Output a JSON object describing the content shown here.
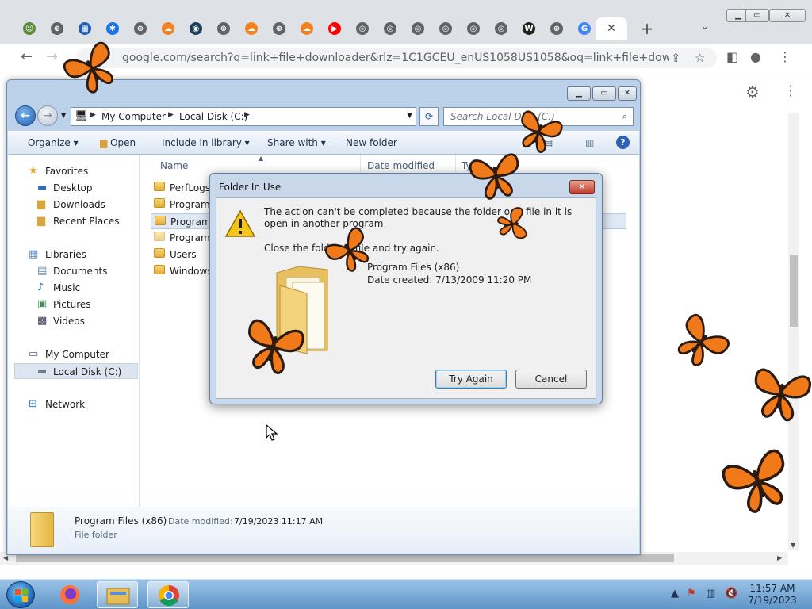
{
  "browser": {
    "url": "google.com/search?q=link+file+downloader&rlz=1C1GCEU_enUS1058US1058&oq=link+file+downloader&...",
    "tabs": [
      {
        "icon": "extension-icon",
        "color": "#5a8a3a",
        "glyph": "☺"
      },
      {
        "icon": "globe-icon",
        "color": "#5f6368",
        "glyph": "⊕"
      },
      {
        "icon": "app-icon",
        "color": "#1a5fb4",
        "glyph": "▦"
      },
      {
        "icon": "gear-icon",
        "color": "#1a73e8",
        "glyph": "✱"
      },
      {
        "icon": "globe-icon",
        "color": "#5f6368",
        "glyph": "⊕"
      },
      {
        "icon": "cloudflare-icon",
        "color": "#f48120",
        "glyph": "☁"
      },
      {
        "icon": "camera-icon",
        "color": "#1c3f5e",
        "glyph": "◉"
      },
      {
        "icon": "globe-icon",
        "color": "#5f6368",
        "glyph": "⊕"
      },
      {
        "icon": "cloudflare-icon",
        "color": "#f48120",
        "glyph": "☁"
      },
      {
        "icon": "globe-icon",
        "color": "#5f6368",
        "glyph": "⊕"
      },
      {
        "icon": "cloudflare-icon",
        "color": "#f48120",
        "glyph": "☁"
      },
      {
        "icon": "youtube-icon",
        "color": "#ff0000",
        "glyph": "▶"
      },
      {
        "icon": "chromium-icon",
        "color": "#5f6368",
        "glyph": "◎"
      },
      {
        "icon": "chromium-icon",
        "color": "#5f6368",
        "glyph": "◎"
      },
      {
        "icon": "chromium-icon",
        "color": "#5f6368",
        "glyph": "◎"
      },
      {
        "icon": "chromium-icon",
        "color": "#5f6368",
        "glyph": "◎"
      },
      {
        "icon": "chromium-icon",
        "color": "#5f6368",
        "glyph": "◎"
      },
      {
        "icon": "chromium-icon",
        "color": "#5f6368",
        "glyph": "◎"
      },
      {
        "icon": "wikipedia-icon",
        "color": "#222222",
        "glyph": "W"
      },
      {
        "icon": "globe-icon",
        "color": "#5f6368",
        "glyph": "⊕"
      },
      {
        "icon": "google-icon",
        "color": "#4285f4",
        "glyph": "G"
      }
    ]
  },
  "explorer": {
    "breadcrumb": [
      "My Computer",
      "Local Disk (C:)"
    ],
    "search_placeholder": "Search Local Disk (C:)",
    "commands": [
      "Organize",
      "Open",
      "Include in library",
      "Share with",
      "New folder"
    ],
    "nav": {
      "favorites": "Favorites",
      "desktop": "Desktop",
      "downloads": "Downloads",
      "recent": "Recent Places",
      "libraries": "Libraries",
      "documents": "Documents",
      "music": "Music",
      "pictures": "Pictures",
      "videos": "Videos",
      "computer": "My Computer",
      "localdisk": "Local Disk (C:)",
      "network": "Network"
    },
    "columns": {
      "name": "Name",
      "date": "Date modified",
      "type": "Type"
    },
    "files": [
      "PerfLogs",
      "Program",
      "Program",
      "ProgramD",
      "Users",
      "Windows"
    ],
    "details": {
      "name": "Program Files (x86)",
      "modified_label": "Date modified:",
      "modified_value": "7/19/2023 11:17 AM",
      "type": "File folder"
    }
  },
  "dialog": {
    "title": "Folder In Use",
    "message": "The action can't be completed because the folder or a file in it is open in another program",
    "hint": "Close the folder or file and try again.",
    "folder_name": "Program Files (x86)",
    "date_created": "Date created: 7/13/2009 11:20 PM",
    "try_again": "Try Again",
    "cancel": "Cancel"
  },
  "taskbar": {
    "time": "11:57 AM",
    "date": "7/19/2023"
  },
  "colors": {
    "butterfly": "#f07a1a",
    "butterfly_dark": "#2b1a10"
  }
}
